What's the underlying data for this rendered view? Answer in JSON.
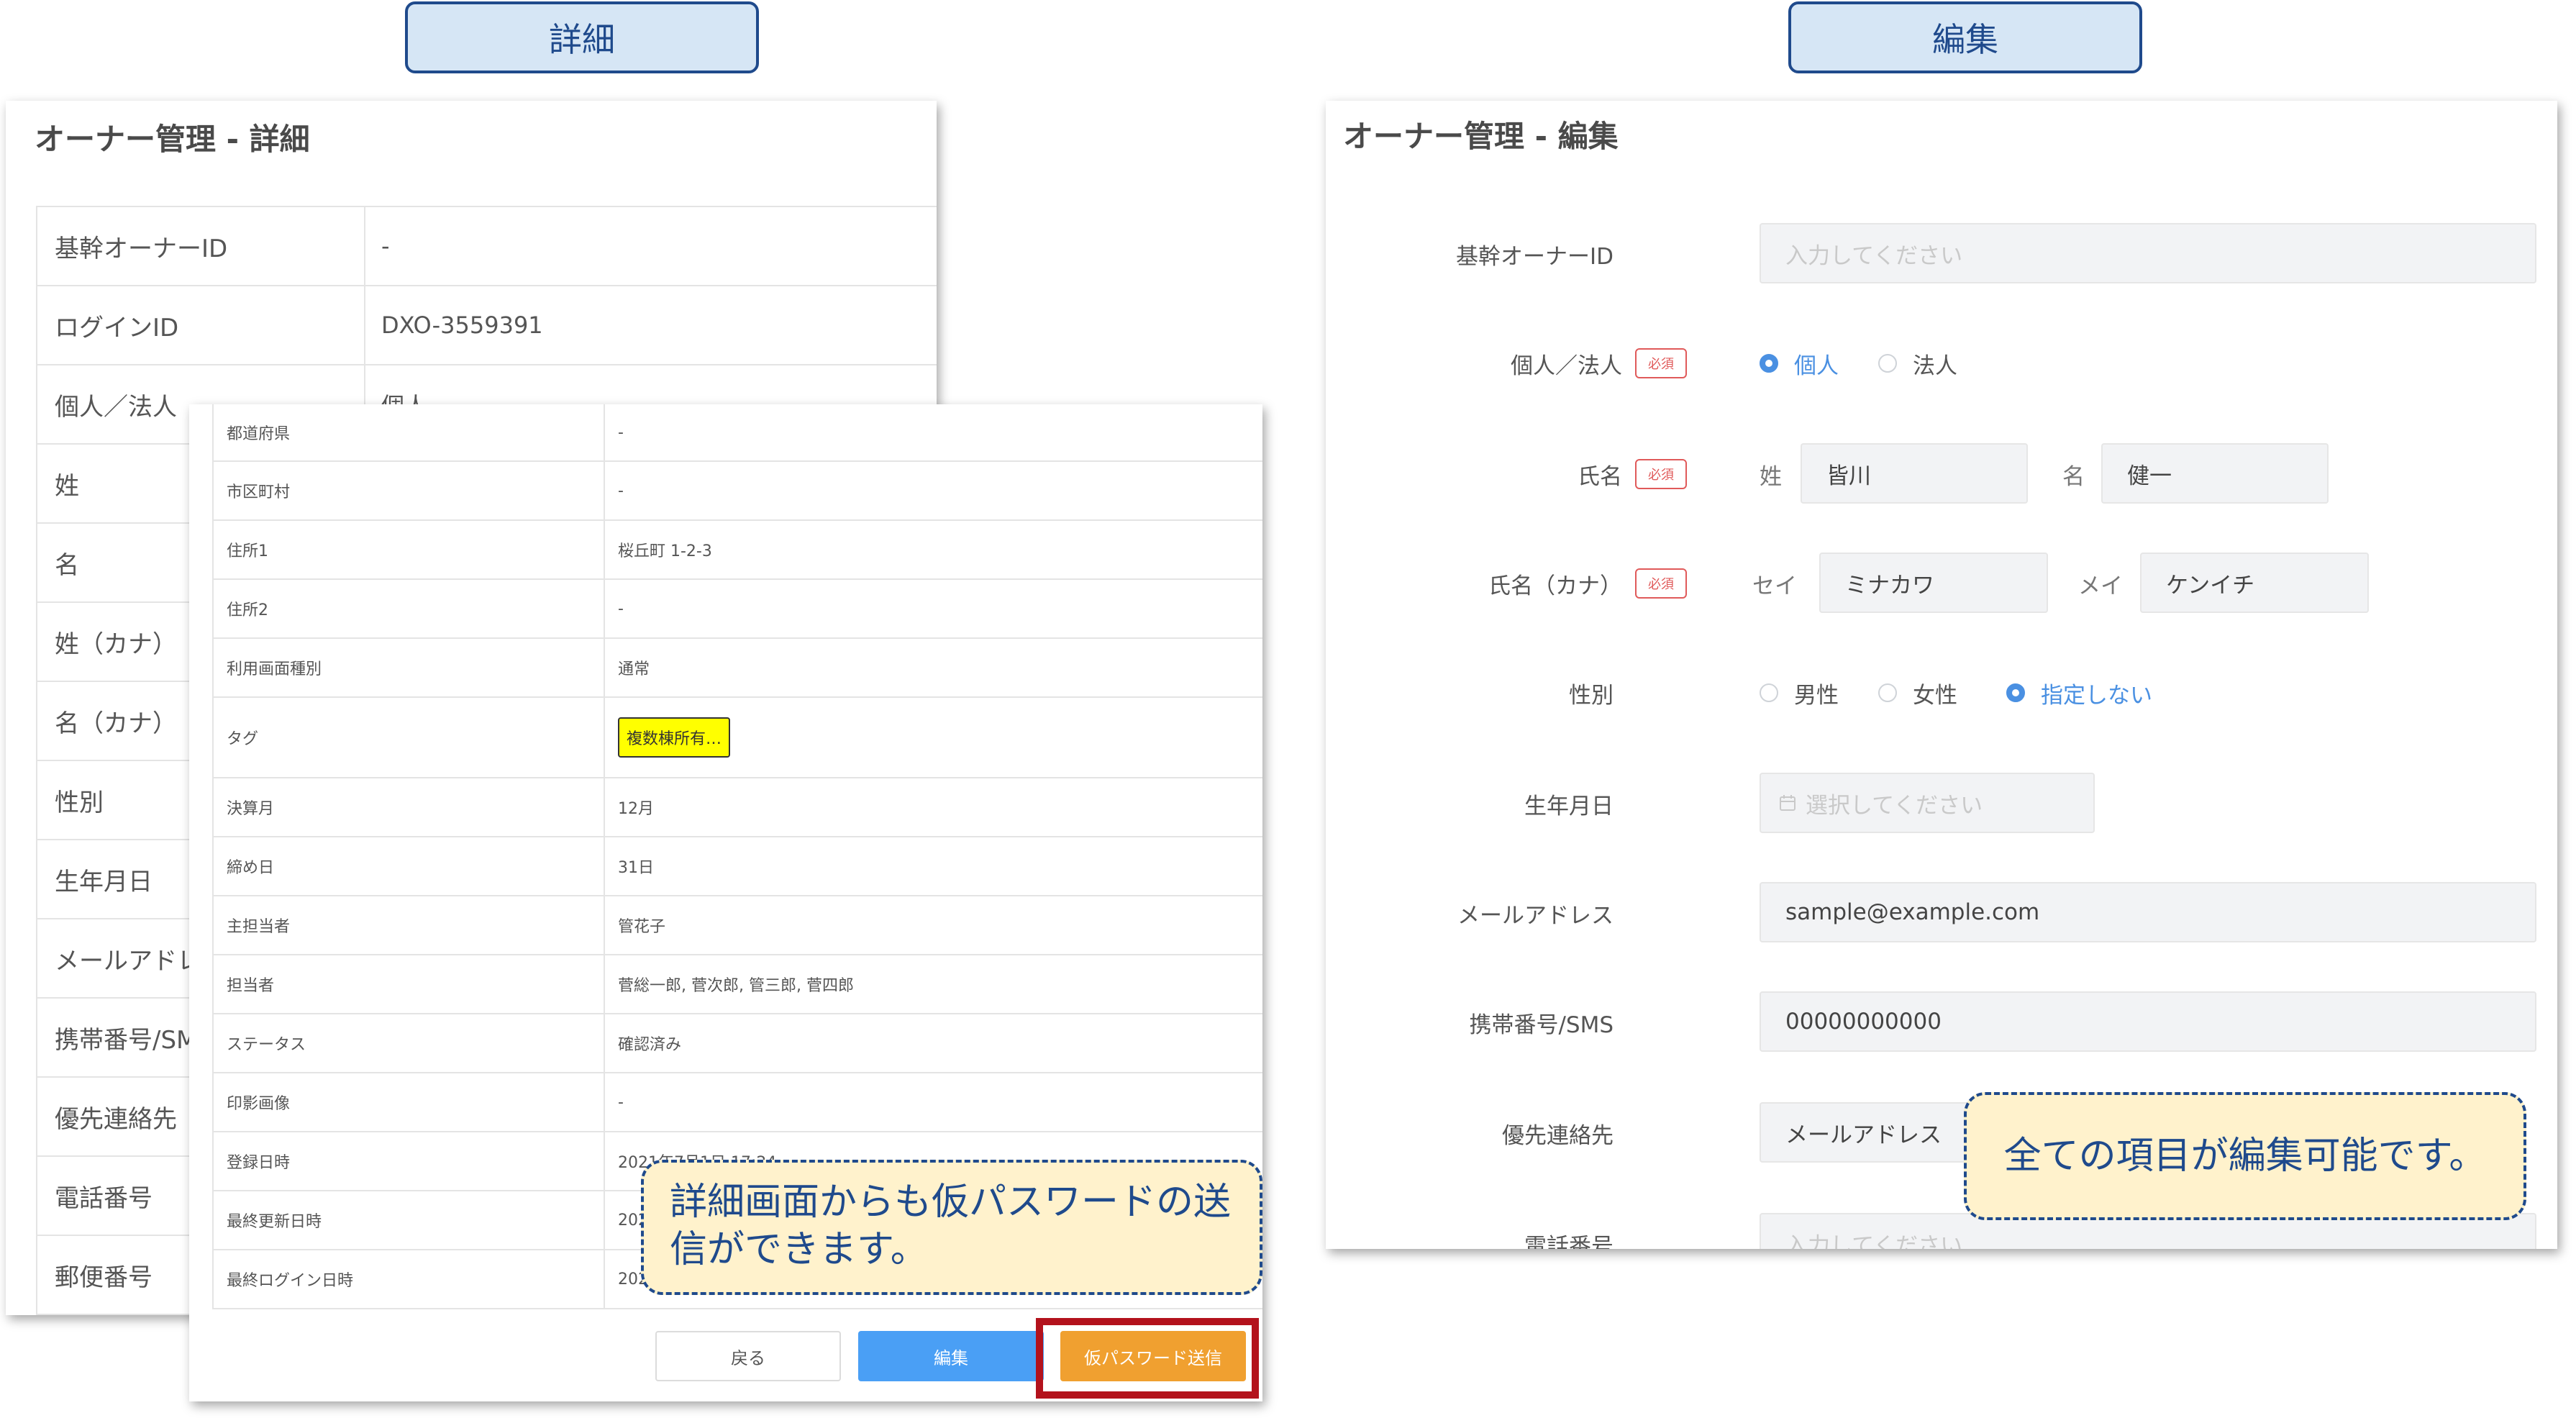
{
  "tabs": {
    "detail": "詳細",
    "edit": "編集"
  },
  "detail": {
    "title": "オーナー管理 - 詳細",
    "rows": [
      {
        "label": "基幹オーナーID",
        "value": "-"
      },
      {
        "label": "ログインID",
        "value": "DXO-3559391"
      },
      {
        "label": "個人／法人",
        "value": "個人"
      },
      {
        "label": "姓",
        "value": ""
      },
      {
        "label": "名",
        "value": ""
      },
      {
        "label": "姓（カナ）",
        "value": ""
      },
      {
        "label": "名（カナ）",
        "value": ""
      },
      {
        "label": "性別",
        "value": ""
      },
      {
        "label": "生年月日",
        "value": ""
      },
      {
        "label": "メールアドレス",
        "value": ""
      },
      {
        "label": "携帯番号/SMS",
        "value": ""
      },
      {
        "label": "優先連絡先",
        "value": ""
      },
      {
        "label": "電話番号",
        "value": ""
      },
      {
        "label": "郵便番号",
        "value": ""
      }
    ]
  },
  "detail_overlay": {
    "rows": [
      {
        "label": "都道府県",
        "value": "-"
      },
      {
        "label": "市区町村",
        "value": "-"
      },
      {
        "label": "住所1",
        "value": "桜丘町 1-2-3"
      },
      {
        "label": "住所2",
        "value": "-"
      },
      {
        "label": "利用画面種別",
        "value": "通常"
      },
      {
        "label": "タグ",
        "tag": "複数棟所有…"
      },
      {
        "label": "決算月",
        "value": "12月"
      },
      {
        "label": "締め日",
        "value": "31日"
      },
      {
        "label": "主担当者",
        "value": "管花子"
      },
      {
        "label": "担当者",
        "value": "菅総一郎, 菅次郎, 管三郎, 菅四郎"
      },
      {
        "label": "ステータス",
        "value": "確認済み"
      },
      {
        "label": "印影画像",
        "value": "-"
      },
      {
        "label": "登録日時",
        "value": "2021年7月1日 17:24"
      },
      {
        "label": "最終更新日時",
        "value": "202"
      },
      {
        "label": "最終ログイン日時",
        "value": "202"
      }
    ],
    "buttons": {
      "back": "戻る",
      "edit": "編集",
      "temp_password": "仮パスワード送信"
    }
  },
  "callout_detail": "詳細画面からも仮パスワードの送信ができます。",
  "edit": {
    "title": "オーナー管理 - 編集",
    "required_badge": "必須",
    "owner_id": {
      "label": "基幹オーナーID",
      "placeholder": "入力してください"
    },
    "type": {
      "label": "個人／法人",
      "options": [
        "個人",
        "法人"
      ],
      "selected": "個人"
    },
    "name": {
      "label": "氏名",
      "last_prefix": "姓",
      "last_value": "皆川",
      "first_prefix": "名",
      "first_value": "健一"
    },
    "kana": {
      "label": "氏名（カナ）",
      "last_prefix": "セイ",
      "last_value": "ミナカワ",
      "first_prefix": "メイ",
      "first_value": "ケンイチ"
    },
    "gender": {
      "label": "性別",
      "options": [
        "男性",
        "女性",
        "指定しない"
      ],
      "selected": "指定しない"
    },
    "birthday": {
      "label": "生年月日",
      "placeholder": "選択してください"
    },
    "email": {
      "label": "メールアドレス",
      "value": "sample@example.com"
    },
    "mobile": {
      "label": "携帯番号/SMS",
      "value": "00000000000"
    },
    "priority": {
      "label": "優先連絡先",
      "value": "メールアドレス"
    },
    "phone": {
      "label": "電話番号",
      "placeholder": "入力してください"
    }
  },
  "callout_edit": "全ての項目が編集可能です。",
  "colors": {
    "accent": "#4a90e2",
    "orange": "#f0a030",
    "highlight": "#b3121c",
    "callout_border": "#1f4a8c",
    "callout_fill": "#fff2cc"
  }
}
